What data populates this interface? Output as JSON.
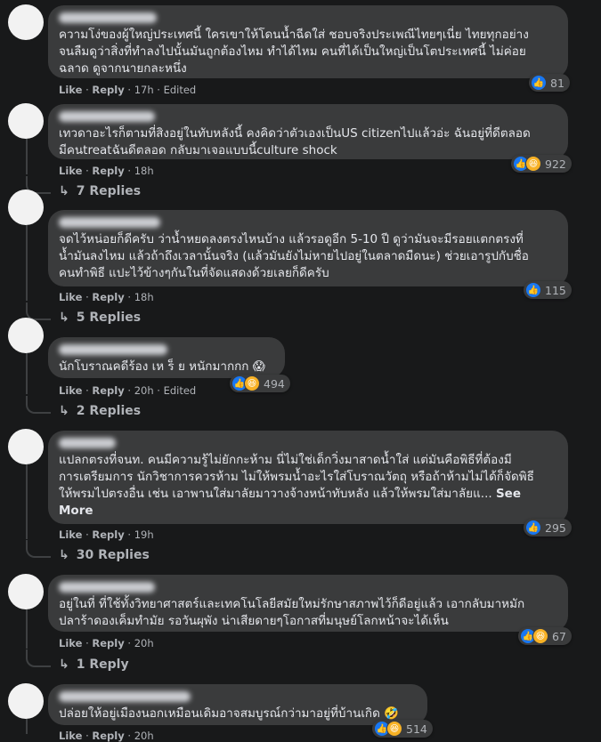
{
  "colors": {
    "background": "#18191a",
    "bubble": "#3a3b3c",
    "text": "#e4e6eb",
    "muted": "#b0b3b8",
    "like_blue": "#1877f2"
  },
  "labels": {
    "like": "Like",
    "reply": "Reply",
    "edited": "Edited",
    "see_more": "See More"
  },
  "comments": [
    {
      "lines": [
        "ความโง่ของผู้ใหญ่ประเทศนี้ ใครเขาให้โดนน้ำฉีดใส่ ชอบจริงประเพณีไทยๆเนี่ย ไทยทุกอย่าง",
        "จนลืมดูว่าสิ่งที่ทำลงไปนั้นมันถูกต้องไหม ทำได้ไหม คนที่ได้เป็นใหญ่เป็นโตประเทศนี้ ไม่ค่อย",
        "ฉลาด ดูจากนายกละหนึ่ง"
      ],
      "time": "17h",
      "edited": true,
      "reactions": [
        "like"
      ],
      "count": "81",
      "replies": ""
    },
    {
      "lines": [
        "เทวดาอะไรก็ตามที่สิงอยู่ในทับหลังนี้ คงคิดว่าตัวเองเป็นUS citizenไปแล้วอ่ะ ฉันอยู่ที่ดีตลอด",
        "มีคนtreatฉันดีตลอด กลับมาเจอแบบนี้culture shock"
      ],
      "time": "18h",
      "edited": false,
      "reactions": [
        "like",
        "haha"
      ],
      "count": "922",
      "replies": "7 Replies"
    },
    {
      "lines": [
        "จดไว้หน่อยก็ดีครับ ว่าน้ำหยดลงตรงไหนบ้าง แล้วรอดูอีก 5-10 ปี ดูว่ามันจะมีรอยแตกตรงที่",
        "น้ำมันลงไหม แล้วถ้าถึงเวลานั้นจริง (แล้วมันยังไม่หายไปอยู่ในตลาดมืดนะ) ช่วยเอารูปกับชื่อ",
        "คนทำพิธี แปะไว้ข้างๆกันในที่จัดแสดงด้วยเลยก็ดีครับ"
      ],
      "time": "18h",
      "edited": false,
      "reactions": [
        "like"
      ],
      "count": "115",
      "replies": "5 Replies"
    },
    {
      "lines": [
        "นักโบราณคดีร้อง เห ร็ ย หนักมากกก 😱"
      ],
      "time": "20h",
      "edited": true,
      "reactions": [
        "like",
        "haha"
      ],
      "count": "494",
      "replies": "2 Replies"
    },
    {
      "lines": [
        "แปลกตรงที่จนท. คนมีความรู้ไม่ยักกะห้าม นี่ไม่ใช่เด็กวิ่งมาสาดน้ำใส่ แต่มันคือพิธีที่ต้องมี",
        "การเตรียมการ นักวิชาการควรห้าม ไม่ให้พรมน้ำอะไรใส่โบราณวัตถุ หรือถ้าห้ามไม่ได้ก็จัดพิธี",
        "ให้พรมไปตรงอื่น เช่น เอาพานใส่มาลัยมาวางจ้างหน้าทับหลัง แล้วให้พรมใส่มาลัยแ..."
      ],
      "time": "19h",
      "edited": false,
      "reactions": [
        "like"
      ],
      "count": "295",
      "replies": "30 Replies"
    },
    {
      "lines": [
        "อยู่ในที่ ที่ใช้ทั้งวิทยาศาสตร์และเทคโนโลยีสมัยใหม่รักษาสภาพไว้ก็ดีอยู่แล้ว เอากลับมาหมัก",
        "ปลาร้าดองเค็มทำมัย รอวันผุพัง น่าเสียดายๆโอกาสที่มนุษย์โลกหน้าจะได้เห็น"
      ],
      "time": "20h",
      "edited": false,
      "reactions": [
        "like",
        "haha"
      ],
      "count": "67",
      "replies": "1 Reply"
    },
    {
      "lines": [
        "ปล่อยให้อยู่เมืองนอกเหมือนเดิมอาจสมบูรณ์กว่ามาอยู่ที่บ้านเกิด 🤣"
      ],
      "time": "20h",
      "edited": false,
      "reactions": [
        "like",
        "haha"
      ],
      "count": "514",
      "replies": ""
    }
  ]
}
